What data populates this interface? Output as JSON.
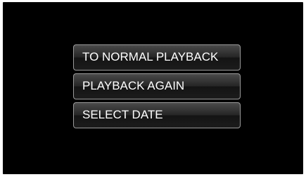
{
  "menu": {
    "items": [
      {
        "label": "TO NORMAL PLAYBACK"
      },
      {
        "label": "PLAYBACK AGAIN"
      },
      {
        "label": "SELECT DATE"
      }
    ]
  }
}
